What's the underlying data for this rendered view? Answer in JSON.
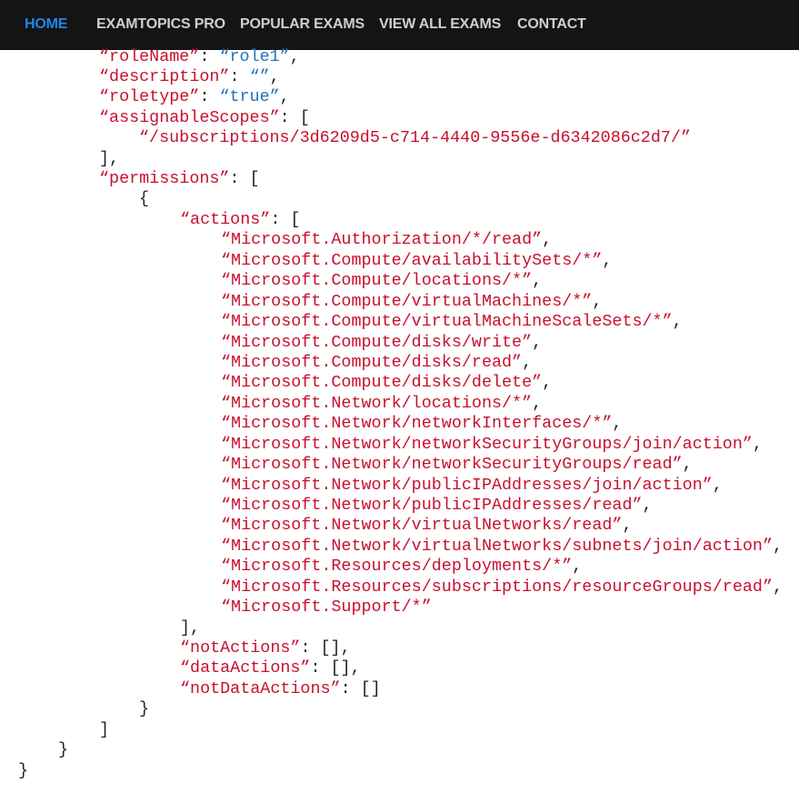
{
  "nav": {
    "items": [
      {
        "label": "HOME",
        "active": true
      },
      {
        "label": "EXAMTOPICS PRO",
        "active": false
      },
      {
        "label": "POPULAR EXAMS",
        "active": false
      },
      {
        "label": "VIEW ALL EXAMS",
        "active": false
      },
      {
        "label": "CONTACT",
        "active": false
      }
    ]
  },
  "code": {
    "roleName_key": "“roleName”",
    "roleName_value": "“role1”",
    "description_key": "“description”",
    "description_value": "“”",
    "roletype_key": "“roletype”",
    "roletype_value": "“true”",
    "assignableScopes_key": "“assignableScopes”",
    "scope": "“/subscriptions/3d6209d5-c714-4440-9556e-d6342086c2d7/”",
    "permissions_key": "“permissions”",
    "actions_key": "“actions”",
    "actions": [
      "“Microsoft.Authorization/*/read”",
      "“Microsoft.Compute/availabilitySets/*”",
      "“Microsoft.Compute/locations/*”",
      "“Microsoft.Compute/virtualMachines/*”",
      "“Microsoft.Compute/virtualMachineScaleSets/*”",
      "“Microsoft.Compute/disks/write”",
      "“Microsoft.Compute/disks/read”",
      "“Microsoft.Compute/disks/delete”",
      "“Microsoft.Network/locations/*”",
      "“Microsoft.Network/networkInterfaces/*”",
      "“Microsoft.Network/networkSecurityGroups/join/action”",
      "“Microsoft.Network/networkSecurityGroups/read”",
      "“Microsoft.Network/publicIPAddresses/join/action”",
      "“Microsoft.Network/publicIPAddresses/read”",
      "“Microsoft.Network/virtualNetworks/read”",
      "“Microsoft.Network/virtualNetworks/subnets/join/action”",
      "“Microsoft.Resources/deployments/*”",
      "“Microsoft.Resources/subscriptions/resourceGroups/read”",
      "“Microsoft.Support/*”"
    ],
    "notActions_key": "“notActions”",
    "dataActions_key": "“dataActions”",
    "notDataActions_key": "“notDataActions”"
  }
}
